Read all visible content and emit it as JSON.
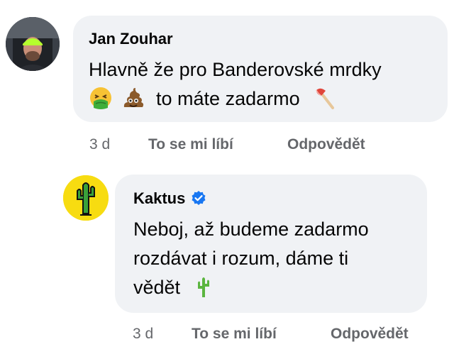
{
  "comments": [
    {
      "author": "Jan Zouhar",
      "avatar": "person-photo-avatar",
      "text_line1": "Hlavně že pro Banderovské mrdky",
      "text_line2_emojis": [
        "nauseated-face-emoji",
        "pile-of-poo-emoji"
      ],
      "text_line2": "to máte zadarmo",
      "text_line2_trailing_emoji": "axe-emoji",
      "time": "3 d",
      "like_label": "To se mi líbí",
      "reply_label": "Odpovědět"
    },
    {
      "author": "Kaktus",
      "avatar": "cactus-avatar",
      "verified": true,
      "text_lines": [
        "Neboj, až budeme zadarmo",
        "rozdávat i rozum, dáme ti",
        "vědět"
      ],
      "trailing_emoji": "cactus-emoji",
      "time": "3 d",
      "like_label": "To se mi líbí",
      "reply_label": "Odpovědět"
    }
  ],
  "colors": {
    "bubble": "#f0f2f5",
    "text": "#050505",
    "secondary": "#65676b",
    "verified": "#1877f2",
    "kaktus_avatar_bg": "#f7dc11"
  }
}
